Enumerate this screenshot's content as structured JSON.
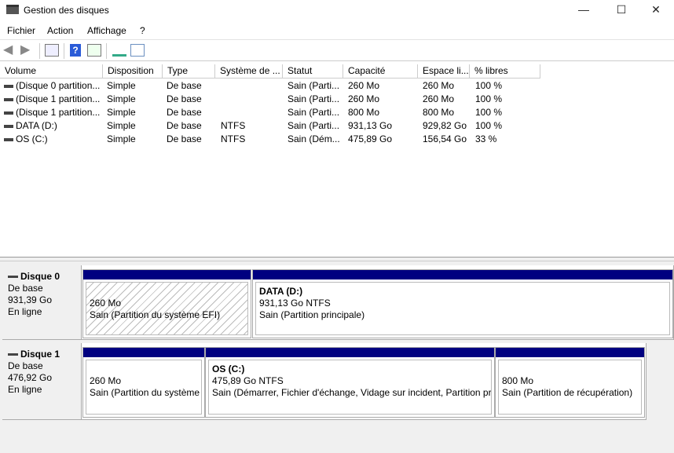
{
  "window": {
    "title": "Gestion des disques",
    "minimize": "—",
    "maximize": "☐",
    "close": "✕"
  },
  "menu": [
    "Fichier",
    "Action",
    "Affichage",
    "?"
  ],
  "toolbar": [
    "back-icon",
    "forward-icon",
    "console-tree-icon",
    "help-icon",
    "action-pane-icon",
    "connect-icon",
    "properties-icon"
  ],
  "list": {
    "columns": [
      "Volume",
      "Disposition",
      "Type",
      "Système de ...",
      "Statut",
      "Capacité",
      "Espace li...",
      "% libres"
    ],
    "rows": [
      [
        "(Disque 0 partition...",
        "Simple",
        "De base",
        "",
        "Sain (Parti...",
        "260 Mo",
        "260 Mo",
        "100 %"
      ],
      [
        "(Disque 1 partition...",
        "Simple",
        "De base",
        "",
        "Sain (Parti...",
        "260 Mo",
        "260 Mo",
        "100 %"
      ],
      [
        "(Disque 1 partition...",
        "Simple",
        "De base",
        "",
        "Sain (Parti...",
        "800 Mo",
        "800 Mo",
        "100 %"
      ],
      [
        "DATA (D:)",
        "Simple",
        "De base",
        "NTFS",
        "Sain (Parti...",
        "931,13 Go",
        "929,82 Go",
        "100 %"
      ],
      [
        "OS (C:)",
        "Simple",
        "De base",
        "NTFS",
        "Sain (Dém...",
        "475,89 Go",
        "156,54 Go",
        "33 %"
      ]
    ]
  },
  "disks": [
    {
      "name": "Disque 0",
      "type": "De base",
      "size": "931,39 Go",
      "status": "En ligne",
      "partitions": [
        {
          "title": "",
          "size": "260 Mo",
          "status": "Sain (Partition du système EFI)"
        },
        {
          "title": "DATA  (D:)",
          "size": "931,13 Go NTFS",
          "status": "Sain (Partition principale)"
        }
      ]
    },
    {
      "name": "Disque 1",
      "type": "De base",
      "size": "476,92 Go",
      "status": "En ligne",
      "partitions": [
        {
          "title": "",
          "size": "260 Mo",
          "status": "Sain (Partition du système"
        },
        {
          "title": "OS  (C:)",
          "size": "475,89 Go NTFS",
          "status": "Sain (Démarrer, Fichier d'échange, Vidage sur incident, Partition pri"
        },
        {
          "title": "",
          "size": "800 Mo",
          "status": "Sain (Partition de récupération)"
        }
      ]
    }
  ]
}
